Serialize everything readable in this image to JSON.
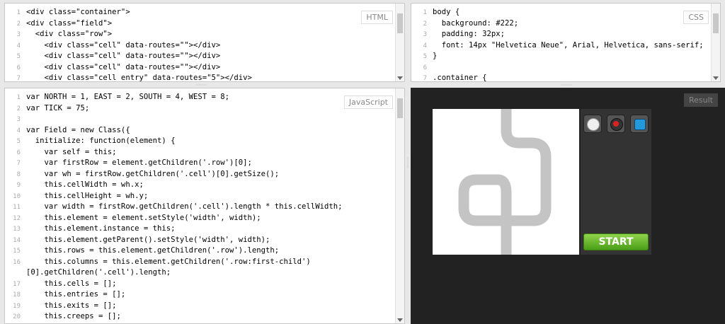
{
  "html_editor": {
    "label": "HTML",
    "lines": [
      {
        "n": "1",
        "text": "<div class=\"container\">"
      },
      {
        "n": "2",
        "text": "<div class=\"field\">"
      },
      {
        "n": "3",
        "text": "  <div class=\"row\">"
      },
      {
        "n": "4",
        "text": "    <div class=\"cell\" data-routes=\"\"></div>"
      },
      {
        "n": "5",
        "text": "    <div class=\"cell\" data-routes=\"\"></div>"
      },
      {
        "n": "6",
        "text": "    <div class=\"cell\" data-routes=\"\"></div>"
      },
      {
        "n": "7",
        "text": "    <div class=\"cell entry\" data-routes=\"5\"></div>"
      }
    ]
  },
  "css_editor": {
    "label": "CSS",
    "lines": [
      {
        "n": "1",
        "text": "body {"
      },
      {
        "n": "2",
        "text": "  background: #222;"
      },
      {
        "n": "3",
        "text": "  padding: 32px;"
      },
      {
        "n": "4",
        "text": "  font: 14px \"Helvetica Neue\", Arial, Helvetica, sans-serif;"
      },
      {
        "n": "5",
        "text": "}"
      },
      {
        "n": "6",
        "text": ""
      },
      {
        "n": "7",
        "text": ".container {"
      }
    ]
  },
  "js_editor": {
    "label": "JavaScript",
    "lines": [
      {
        "n": "1",
        "text": "var NORTH = 1, EAST = 2, SOUTH = 4, WEST = 8;"
      },
      {
        "n": "2",
        "text": "var TICK = 75;"
      },
      {
        "n": "3",
        "text": ""
      },
      {
        "n": "4",
        "text": "var Field = new Class({"
      },
      {
        "n": "5",
        "text": "  initialize: function(element) {"
      },
      {
        "n": "6",
        "text": "    var self = this;"
      },
      {
        "n": "7",
        "text": "    var firstRow = element.getChildren('.row')[0];"
      },
      {
        "n": "8",
        "text": "    var wh = firstRow.getChildren('.cell')[0].getSize();"
      },
      {
        "n": "9",
        "text": "    this.cellWidth = wh.x;"
      },
      {
        "n": "10",
        "text": "    this.cellHeight = wh.y;"
      },
      {
        "n": "11",
        "text": "    var width = firstRow.getChildren('.cell').length * this.cellWidth;"
      },
      {
        "n": "12",
        "text": "    this.element = element.setStyle('width', width);"
      },
      {
        "n": "13",
        "text": "    this.element.instance = this;"
      },
      {
        "n": "14",
        "text": "    this.element.getParent().setStyle('width', width);"
      },
      {
        "n": "15",
        "text": "    this.rows = this.element.getChildren('.row').length;"
      },
      {
        "n": "16",
        "text": "    this.columns = this.element.getChildren('.row:first-child')"
      },
      {
        "n": "",
        "text": "[0].getChildren('.cell').length;"
      },
      {
        "n": "17",
        "text": "    this.cells = [];"
      },
      {
        "n": "18",
        "text": "    this.entries = [];"
      },
      {
        "n": "19",
        "text": "    this.exits = [];"
      },
      {
        "n": "20",
        "text": "    this.creeps = [];"
      }
    ]
  },
  "result": {
    "label": "Result",
    "start_label": "START",
    "tools": [
      {
        "icon": "knob-icon",
        "color": "#eeeeee"
      },
      {
        "icon": "red-button-icon",
        "color": "#dd2222"
      },
      {
        "icon": "blue-square-icon",
        "color": "#2299dd"
      }
    ]
  }
}
